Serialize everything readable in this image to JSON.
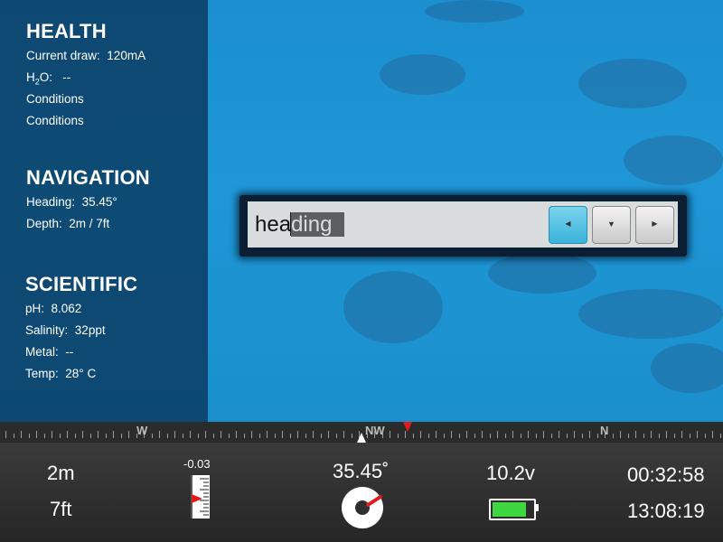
{
  "health": {
    "title": "HEALTH",
    "current_draw_label": "Current draw:",
    "current_draw_value": "120mA",
    "h2o_label_h": "H",
    "h2o_label_sub": "2",
    "h2o_label_o": "O:",
    "h2o_value": "--",
    "conditions_1": "Conditions",
    "conditions_2": "Conditions"
  },
  "navigation": {
    "title": "NAVIGATION",
    "heading_label": "Heading:",
    "heading_value": "35.45°",
    "depth_label": "Depth:",
    "depth_value": "2m / 7ft"
  },
  "scientific": {
    "title": "SCIENTIFIC",
    "ph_label": "pH:",
    "ph_value": "8.062",
    "salinity_label": "Salinity:",
    "salinity_value": "32ppt",
    "metal_label": "Metal:",
    "metal_value": "--",
    "temp_label": "Temp:",
    "temp_value": "28° C"
  },
  "input_dialog": {
    "typed_before_caret": "hea",
    "selected_after_caret": "ding",
    "buttons": [
      {
        "name": "left",
        "glyph": "◀",
        "active": true
      },
      {
        "name": "down",
        "glyph": "▼",
        "active": false
      },
      {
        "name": "right",
        "glyph": "▶",
        "active": false
      }
    ]
  },
  "compass": {
    "labels": [
      "W",
      "NW",
      "N"
    ],
    "needle_color": "#e21a1a"
  },
  "status_bar": {
    "depth_m": "2m",
    "depth_ft": "7ft",
    "gauge_value": "-0.03",
    "heading": "35.45˚",
    "voltage": "10.2v",
    "elapsed_time": "00:32:58",
    "clock_time": "13:08:19",
    "battery_level": 0.85,
    "battery_color": "#3fd73f",
    "accent_red": "#e21a1a"
  }
}
